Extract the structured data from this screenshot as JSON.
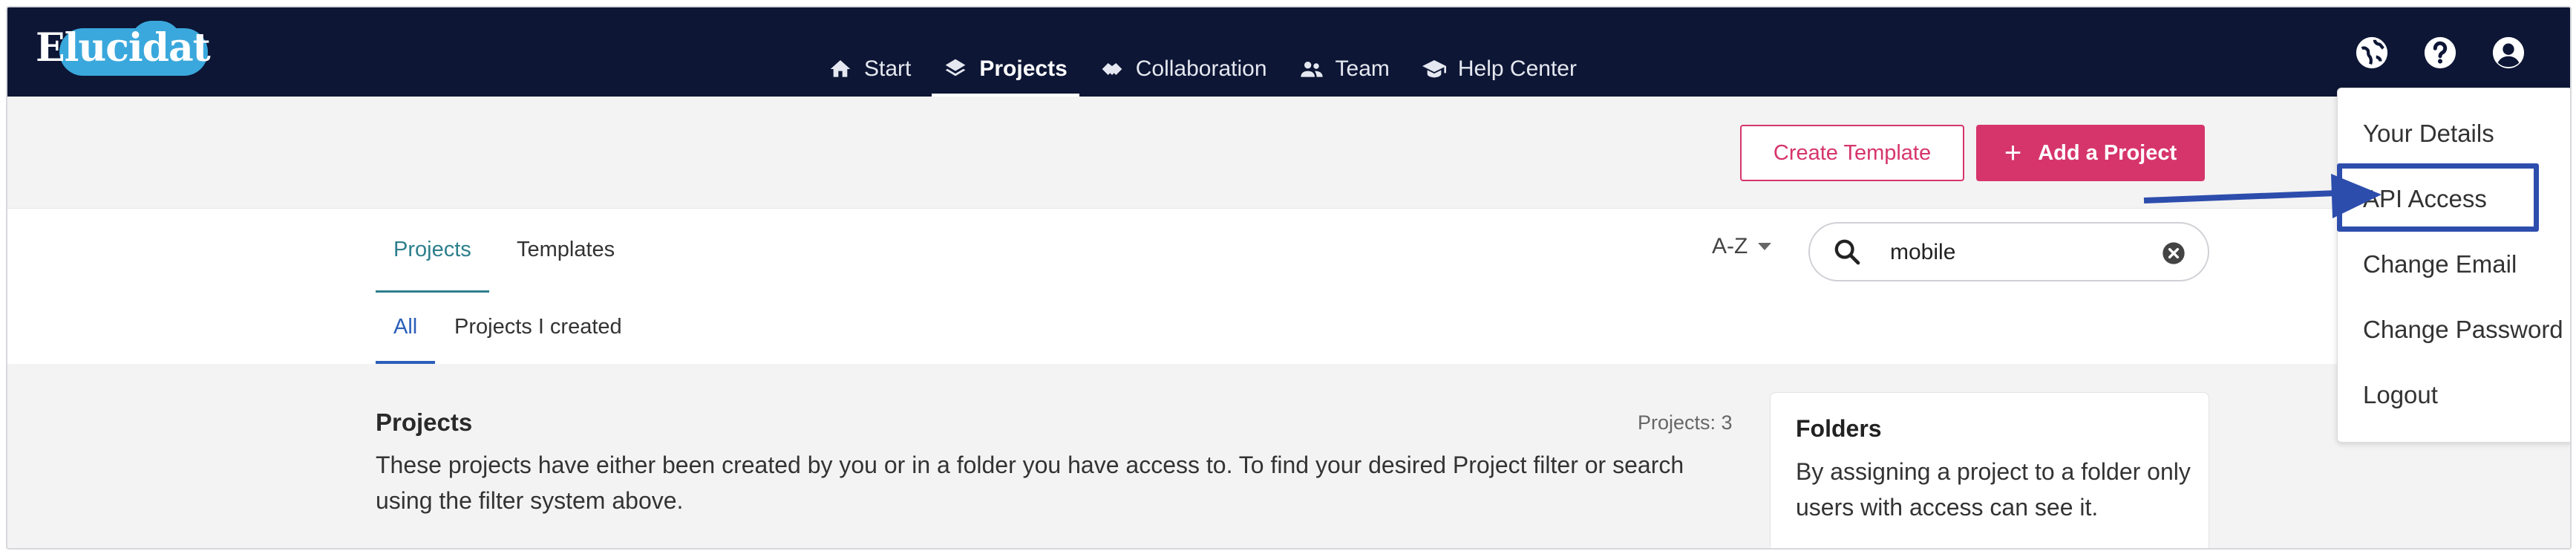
{
  "app": {
    "logo_text": "Elucidat"
  },
  "nav": {
    "items": [
      {
        "label": "Start",
        "icon": "home-icon"
      },
      {
        "label": "Projects",
        "icon": "layers-icon"
      },
      {
        "label": "Collaboration",
        "icon": "handshake-icon"
      },
      {
        "label": "Team",
        "icon": "users-icon"
      },
      {
        "label": "Help Center",
        "icon": "graduation-cap-icon"
      }
    ],
    "active": "Projects",
    "right_icons": [
      "globe-icon",
      "help-icon",
      "user-account-icon"
    ]
  },
  "actions": {
    "create_template": "Create Template",
    "add_project": "Add a Project"
  },
  "tabs": {
    "projects": "Projects",
    "templates": "Templates"
  },
  "sort": {
    "label": "A-Z"
  },
  "search": {
    "value": "mobile"
  },
  "subtabs": {
    "all": "All",
    "created": "Projects I created"
  },
  "content": {
    "title": "Projects",
    "count": "Projects: 3",
    "description": "These projects have either been created by you or in a folder you have access to. To find your desired Project filter or search using the filter system above."
  },
  "folders": {
    "title": "Folders",
    "description": "By assigning a project to a folder only users with access can see it."
  },
  "account_menu": {
    "items": [
      "Your Details",
      "API Access",
      "Change Email",
      "Change Password",
      "Logout"
    ],
    "highlighted": "API Access"
  },
  "colors": {
    "topbar": "#0d1635",
    "accent": "#d6356b",
    "tab_active": "#2d7f8c",
    "subtab_active": "#2b5fb8",
    "annotation": "#2d4dad"
  }
}
